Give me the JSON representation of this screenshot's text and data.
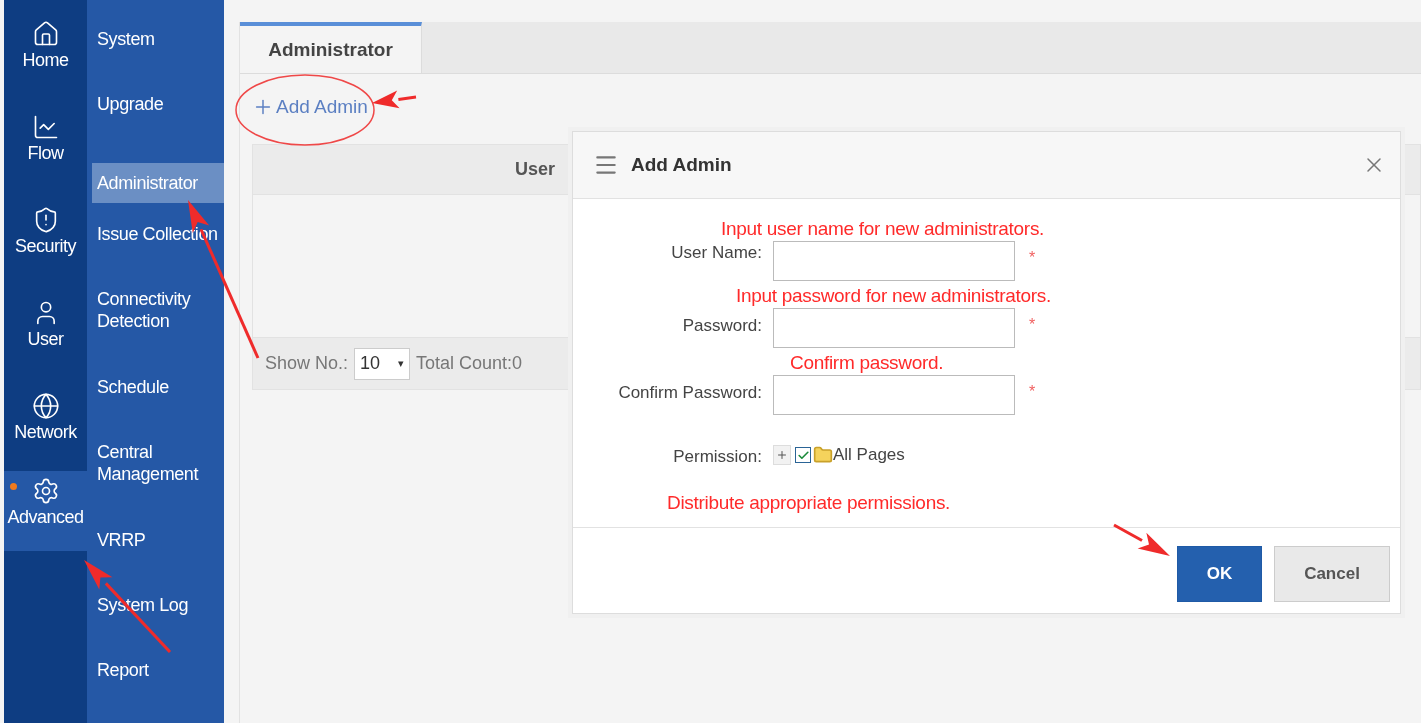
{
  "rail": [
    {
      "label": "Home",
      "selected": false,
      "notice": false
    },
    {
      "label": "Flow",
      "selected": false,
      "notice": false
    },
    {
      "label": "Security",
      "selected": false,
      "notice": false
    },
    {
      "label": "User",
      "selected": false,
      "notice": false
    },
    {
      "label": "Network",
      "selected": false,
      "notice": false
    },
    {
      "label": "Advanced",
      "selected": true,
      "notice": true
    }
  ],
  "submenu": [
    {
      "label": "System",
      "selected": false
    },
    {
      "label": "Upgrade",
      "selected": false
    },
    {
      "label": "Administrator",
      "selected": true
    },
    {
      "label": "Issue Collection",
      "selected": false
    },
    {
      "label": "Connectivity Detection",
      "selected": false
    },
    {
      "label": "Schedule",
      "selected": false
    },
    {
      "label": "Central Management",
      "selected": false
    },
    {
      "label": "VRRP",
      "selected": false
    },
    {
      "label": "System Log",
      "selected": false
    },
    {
      "label": "Report",
      "selected": false
    }
  ],
  "tabs": [
    {
      "label": "Administrator",
      "selected": true
    }
  ],
  "add_link": "Add Admin",
  "table": {
    "columns": [
      "User"
    ],
    "pager": {
      "show_label": "Show No.:",
      "page_size": "10",
      "caret": "▾",
      "total": "Total Count:0"
    }
  },
  "dialog": {
    "title": "Add Admin",
    "fields": [
      {
        "label": "User Name:",
        "note": "Input user name for new administrators.",
        "required_mark": "*"
      },
      {
        "label": "Password:",
        "note": "Input password for new administrators.",
        "required_mark": "*"
      },
      {
        "label": "Confirm Password:",
        "note": "Confirm password.",
        "required_mark": "*"
      }
    ],
    "permission": {
      "label": "Permission:",
      "expanded": false,
      "checked": true,
      "node": "All Pages"
    },
    "note": "Distribute appropriate permissions.",
    "buttons": [
      {
        "label": "OK",
        "kind": "primary"
      },
      {
        "label": "Cancel",
        "kind": "secondary"
      }
    ]
  }
}
